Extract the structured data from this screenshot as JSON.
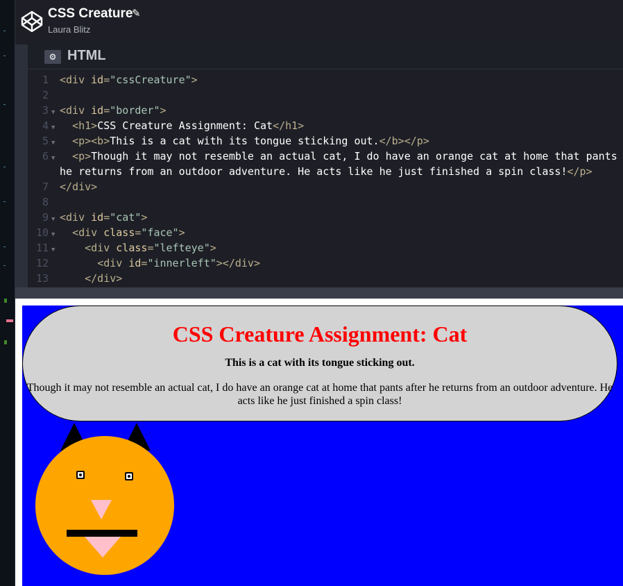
{
  "header": {
    "title": "CSS Creature",
    "author": "Laura Blitz",
    "edit_icon": "pencil-icon",
    "logo_icon": "codepen-logo-icon"
  },
  "editor": {
    "language": "HTML",
    "settings_icon": "gear-icon",
    "lines": [
      {
        "num": "1",
        "fold": false,
        "parts": [
          [
            "tg",
            "<div "
          ],
          [
            "at",
            "id"
          ],
          [
            "tg",
            "="
          ],
          [
            "av",
            "\"cssCreature\""
          ],
          [
            "tg",
            ">"
          ]
        ]
      },
      {
        "num": "2",
        "fold": false,
        "parts": []
      },
      {
        "num": "3",
        "fold": true,
        "parts": [
          [
            "tg",
            "<div "
          ],
          [
            "at",
            "id"
          ],
          [
            "tg",
            "="
          ],
          [
            "av",
            "\"border\""
          ],
          [
            "tg",
            ">"
          ]
        ]
      },
      {
        "num": "4",
        "fold": true,
        "parts": [
          [
            "tx",
            "  "
          ],
          [
            "tg",
            "<h1>"
          ],
          [
            "tx",
            "CSS Creature Assignment: Cat"
          ],
          [
            "tg",
            "</h1>"
          ]
        ]
      },
      {
        "num": "5",
        "fold": true,
        "parts": [
          [
            "tx",
            "  "
          ],
          [
            "tg",
            "<p><b>"
          ],
          [
            "tx",
            "This is a cat with its tongue sticking out."
          ],
          [
            "tg",
            "</b></p>"
          ]
        ]
      },
      {
        "num": "6",
        "fold": true,
        "parts": [
          [
            "tx",
            "  "
          ],
          [
            "tg",
            "<p>"
          ],
          [
            "tx",
            "Though it may not resemble an actual cat, I do have an orange cat at home that pants a"
          ]
        ]
      },
      {
        "num": "",
        "fold": false,
        "parts": [
          [
            "tx",
            "he returns from an outdoor adventure. He acts like he just finished a spin class!"
          ],
          [
            "tg",
            "</p>"
          ]
        ]
      },
      {
        "num": "7",
        "fold": false,
        "parts": [
          [
            "tg",
            "</div>"
          ]
        ]
      },
      {
        "num": "8",
        "fold": false,
        "parts": []
      },
      {
        "num": "9",
        "fold": true,
        "parts": [
          [
            "tg",
            "<div "
          ],
          [
            "at",
            "id"
          ],
          [
            "tg",
            "="
          ],
          [
            "av",
            "\"cat\""
          ],
          [
            "tg",
            ">"
          ]
        ]
      },
      {
        "num": "10",
        "fold": true,
        "parts": [
          [
            "tx",
            "  "
          ],
          [
            "tg",
            "<div "
          ],
          [
            "at",
            "class"
          ],
          [
            "tg",
            "="
          ],
          [
            "av",
            "\"face\""
          ],
          [
            "tg",
            ">"
          ]
        ]
      },
      {
        "num": "11",
        "fold": true,
        "parts": [
          [
            "tx",
            "    "
          ],
          [
            "tg",
            "<div "
          ],
          [
            "at",
            "class"
          ],
          [
            "tg",
            "="
          ],
          [
            "av",
            "\"lefteye\""
          ],
          [
            "tg",
            ">"
          ]
        ]
      },
      {
        "num": "12",
        "fold": false,
        "parts": [
          [
            "tx",
            "      "
          ],
          [
            "tg",
            "<div "
          ],
          [
            "at",
            "id"
          ],
          [
            "tg",
            "="
          ],
          [
            "av",
            "\"innerleft\""
          ],
          [
            "tg",
            "></div>"
          ]
        ]
      },
      {
        "num": "13",
        "fold": false,
        "parts": [
          [
            "tx",
            "    "
          ],
          [
            "tg",
            "</div>"
          ]
        ]
      }
    ]
  },
  "preview": {
    "heading": "CSS Creature Assignment: Cat",
    "bold_line": "This is a cat with its tongue sticking out.",
    "paragraph": "Though it may not resemble an actual cat, I do have an orange cat at home that pants after he returns from an outdoor adventure. He acts like he just finished a spin class!"
  },
  "colors": {
    "preview_bg": "#0000ff",
    "border_box": "#d3d3d3",
    "heading": "#ff0000",
    "face": "#ffa500",
    "nose_tongue": "#ffc0cb"
  }
}
